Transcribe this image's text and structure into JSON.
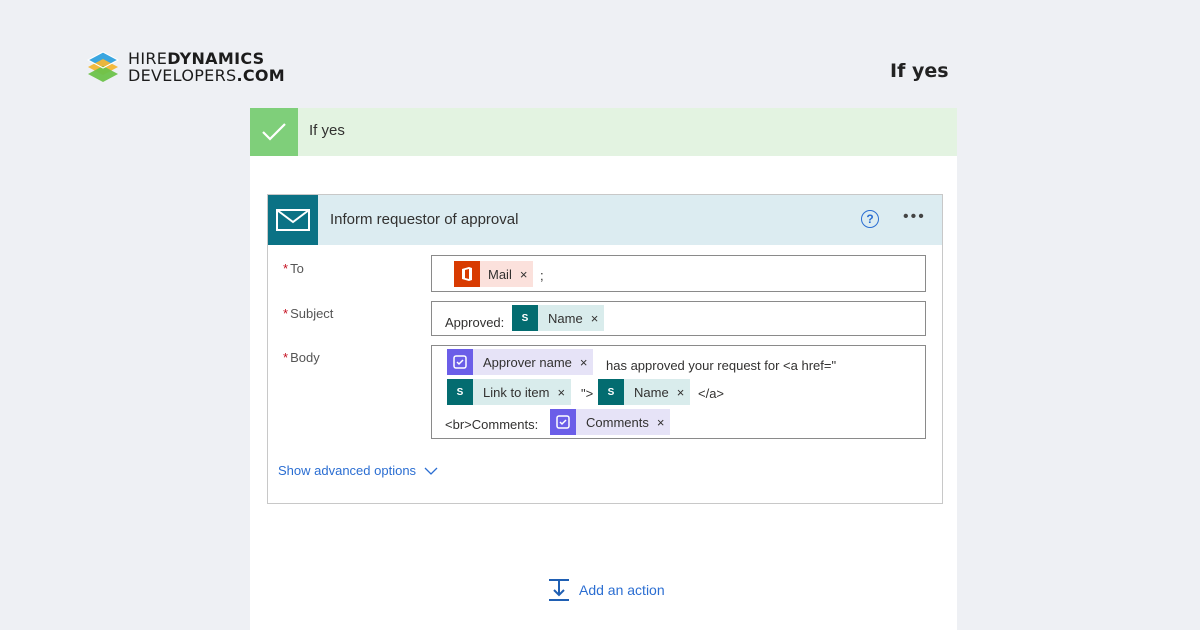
{
  "brand": {
    "line1_a": "HIRE",
    "line1_b": "DYNAMICS",
    "line2_a": "DEVELOPERS",
    "line2_b": ".COM"
  },
  "page_title": "If yes",
  "condition": {
    "label": "If yes",
    "icon": "checkmark-icon",
    "accent": "#7fcf7a"
  },
  "action_card": {
    "title": "Inform requestor of approval",
    "icons": [
      "mail-icon",
      "help-icon",
      "more-icon"
    ],
    "fields": {
      "to": {
        "label": "To",
        "tokens": [
          {
            "source": "office-icon",
            "text": "Mail"
          }
        ],
        "suffix": ";"
      },
      "subject": {
        "label": "Subject",
        "prefix": "Approved:",
        "tokens": [
          {
            "source": "sharepoint-icon",
            "text": "Name"
          }
        ]
      },
      "body": {
        "label": "Body",
        "token_approver": "Approver name",
        "text_1": "has approved your request for <a href=\"",
        "token_link": "Link to item",
        "text_2": "\">",
        "token_name": "Name",
        "text_3": "</a>",
        "text_4": "<br>Comments:",
        "token_comments": "Comments"
      }
    },
    "show_advanced": "Show advanced options"
  },
  "add_action": "Add an action",
  "token_remove_glyph": "×",
  "required_glyph": "*",
  "colors": {
    "background": "#eef0f4",
    "link": "#2b6ed2",
    "office": "#d83b01",
    "sharepoint": "#036c70",
    "approvals": "#6b5ee8",
    "header": "#dcecf1"
  }
}
